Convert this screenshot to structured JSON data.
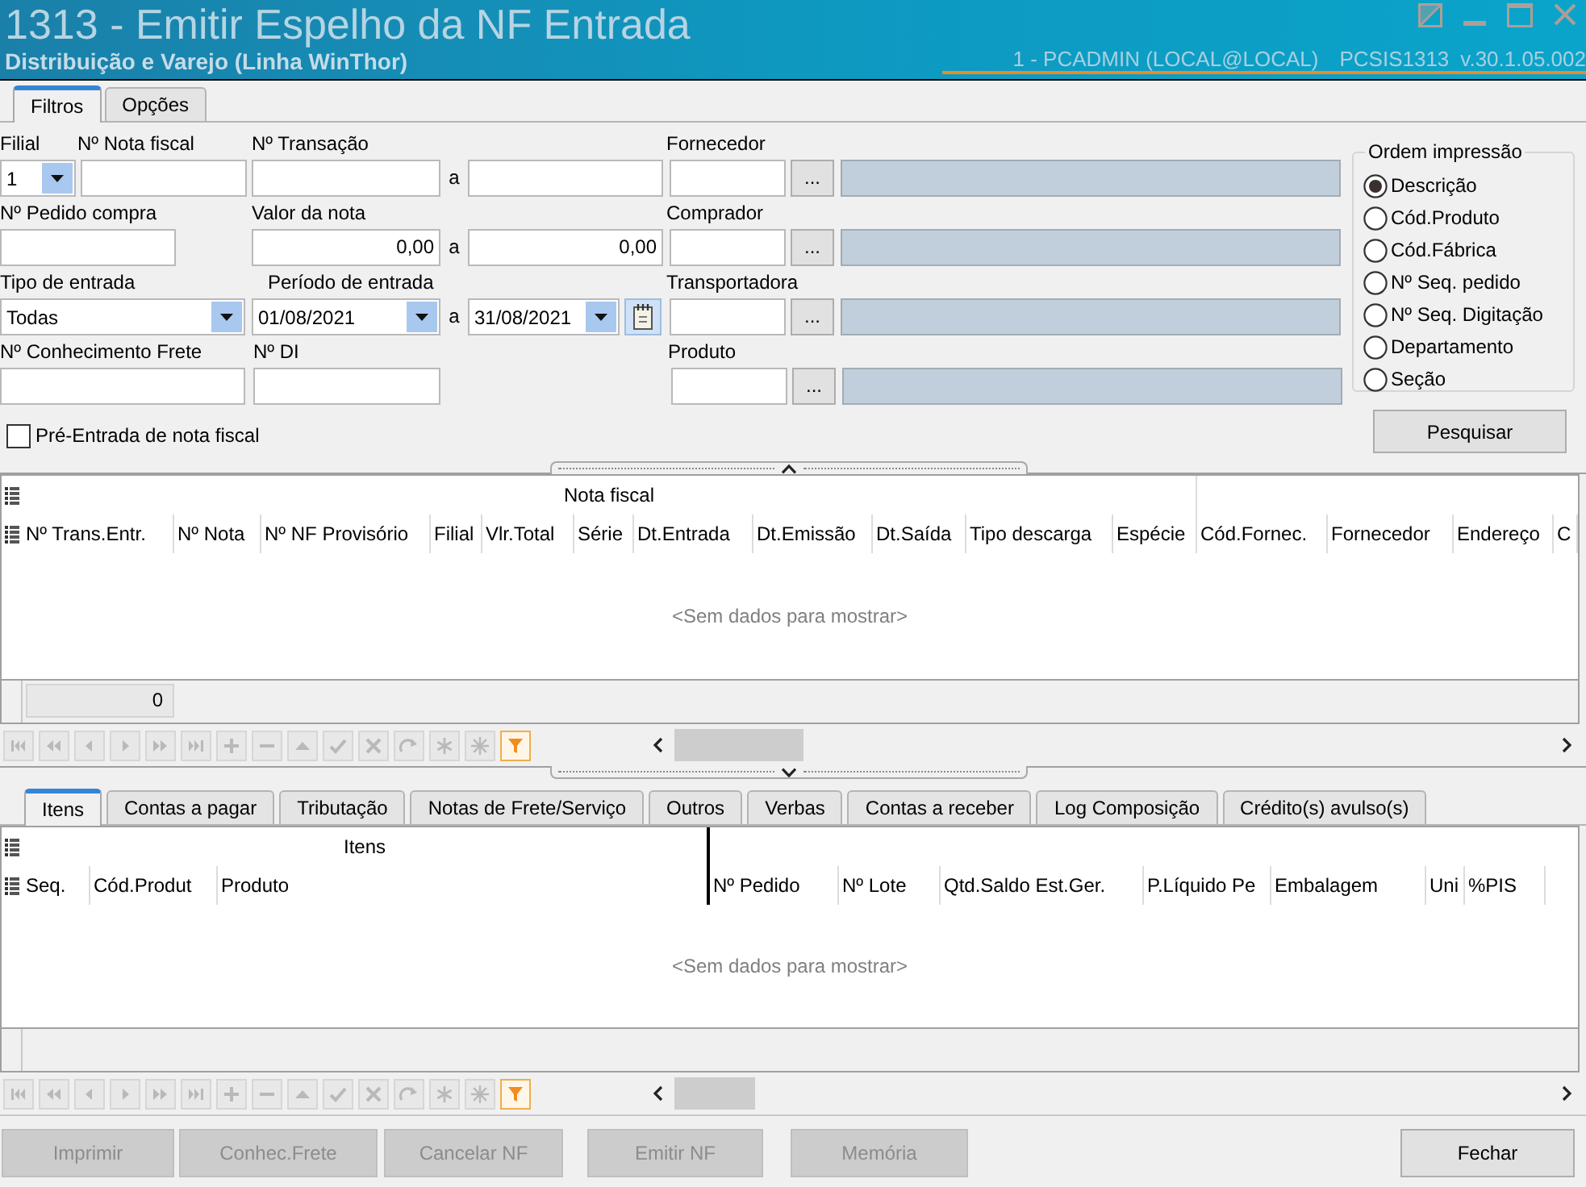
{
  "window": {
    "title": "1313 - Emitir Espelho da NF Entrada",
    "subtitle": "Distribuição e Varejo (Linha WinThor)",
    "session": "1 - PCADMIN (LOCAL@LOCAL)",
    "program": "PCSIS1313",
    "version": "v.30.1.05.002"
  },
  "tabs": [
    {
      "label": "Filtros",
      "selected": true
    },
    {
      "label": "Opções",
      "selected": false
    }
  ],
  "filters": {
    "branch": {
      "label": "Filial",
      "value": "1"
    },
    "invoice_number": {
      "label": "Nº Nota fiscal"
    },
    "transaction": {
      "label": "Nº Transação",
      "separator": "a"
    },
    "purchase_order": {
      "label": "Nº Pedido compra"
    },
    "invoice_value": {
      "label": "Valor da nota",
      "from": "0,00",
      "separator": "a",
      "to": "0,00"
    },
    "entry_type": {
      "label": "Tipo de entrada",
      "value": "Todas"
    },
    "entry_period": {
      "label": "Período de entrada",
      "from": "01/08/2021",
      "separator": "a",
      "to": "31/08/2021"
    },
    "freight_bill": {
      "label": "Nº Conhecimento Frete"
    },
    "import_declaration": {
      "label": "Nº DI"
    },
    "lookups": [
      {
        "label": "Fornecedor",
        "button": "..."
      },
      {
        "label": "Comprador",
        "button": "..."
      },
      {
        "label": "Transportadora",
        "button": "..."
      },
      {
        "label": "Produto",
        "button": "..."
      }
    ],
    "pre_entry": {
      "label": "Pré-Entrada de nota fiscal",
      "checked": false
    }
  },
  "print_order": {
    "title": "Ordem impressão",
    "options": [
      {
        "label": "Descrição",
        "selected": true
      },
      {
        "label": "Cód.Produto",
        "selected": false
      },
      {
        "label": "Cód.Fábrica",
        "selected": false
      },
      {
        "label": "Nº Seq. pedido",
        "selected": false
      },
      {
        "label": "Nº Seq. Digitação",
        "selected": false
      },
      {
        "label": "Departamento",
        "selected": false
      },
      {
        "label": "Seção",
        "selected": false
      }
    ]
  },
  "search_button": "Pesquisar",
  "invoice_grid": {
    "band": "Nota fiscal",
    "columns": [
      "Nº Trans.Entr.",
      "Nº Nota",
      "Nº NF Provisório",
      "Filial",
      "Vlr.Total",
      "Série",
      "Dt.Entrada",
      "Dt.Emissão",
      "Dt.Saída",
      "Tipo descarga",
      "Espécie",
      "Cód.Fornec.",
      "Fornecedor",
      "Endereço",
      "C"
    ],
    "empty_text": "<Sem dados para mostrar>",
    "total": "0"
  },
  "detail_tabs": [
    {
      "label": "Itens",
      "selected": true
    },
    {
      "label": "Contas a pagar",
      "selected": false
    },
    {
      "label": "Tributação",
      "selected": false
    },
    {
      "label": "Notas de Frete/Serviço",
      "selected": false
    },
    {
      "label": "Outros",
      "selected": false
    },
    {
      "label": "Verbas",
      "selected": false
    },
    {
      "label": "Contas a receber",
      "selected": false
    },
    {
      "label": "Log Composição",
      "selected": false
    },
    {
      "label": "Crédito(s) avulso(s)",
      "selected": false
    }
  ],
  "items_grid": {
    "band": "Itens",
    "columns": [
      "Seq.",
      "Cód.Produt",
      "Produto",
      "Nº Pedido",
      "Nº Lote",
      "Qtd.Saldo Est.Ger.",
      "P.Líquido Pe",
      "Embalagem",
      "Uni",
      "%PIS"
    ],
    "empty_text": "<Sem dados para mostrar>"
  },
  "actions": [
    {
      "label": "Imprimir",
      "disabled": true
    },
    {
      "label": "Conhec.Frete",
      "disabled": true
    },
    {
      "label": "Cancelar NF",
      "disabled": true
    },
    {
      "label": "Emitir NF",
      "disabled": true
    },
    {
      "label": "Memória",
      "disabled": true
    }
  ],
  "close_button": {
    "label": "Fechar",
    "disabled": false
  }
}
